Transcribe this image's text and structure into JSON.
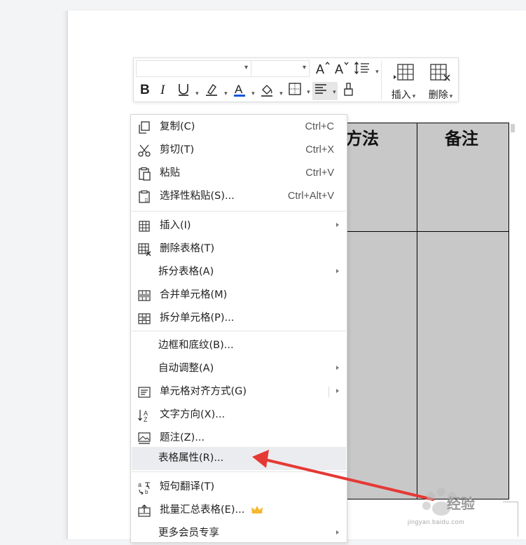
{
  "table": {
    "header_col1": "方法",
    "header_col2": "备注"
  },
  "toolbar": {
    "font_name": "",
    "font_size": "",
    "caret": "▾",
    "insert_label": "插入",
    "delete_label": "删除"
  },
  "menu": {
    "items": [
      {
        "label": "复制(C)",
        "shortcut": "Ctrl+C",
        "icon": "copy-icon"
      },
      {
        "label": "剪切(T)",
        "shortcut": "Ctrl+X",
        "icon": "scissors-icon"
      },
      {
        "label": "粘贴",
        "shortcut": "Ctrl+V",
        "icon": "paste-icon"
      },
      {
        "label": "选择性粘贴(S)...",
        "shortcut": "Ctrl+Alt+V",
        "icon": "paste-special-icon"
      },
      {
        "label": "插入(I)",
        "icon": "table-insert-icon"
      },
      {
        "label": "删除表格(T)",
        "icon": "table-delete-icon"
      },
      {
        "label": "拆分表格(A)"
      },
      {
        "label": "合并单元格(M)",
        "icon": "merge-cells-icon"
      },
      {
        "label": "拆分单元格(P)...",
        "icon": "split-cells-icon"
      },
      {
        "label": "边框和底纹(B)..."
      },
      {
        "label": "自动调整(A)"
      },
      {
        "label": "单元格对齐方式(G)",
        "icon": "cell-align-icon"
      },
      {
        "label": "文字方向(X)...",
        "icon": "text-direction-icon"
      },
      {
        "label": "题注(Z)...",
        "icon": "caption-icon"
      },
      {
        "label": "表格属性(R)..."
      },
      {
        "label": "短句翻译(T)",
        "icon": "translate-icon"
      },
      {
        "label": "批量汇总表格(E)...",
        "icon": "batch-summary-icon"
      },
      {
        "label": "更多会员专享"
      }
    ],
    "hovered_item": "表格属性(R)..."
  },
  "watermark": {
    "text": "经验",
    "url": "jingyan.baidu.com"
  },
  "colors": {
    "accent_blue": "#1a56db",
    "arrow_red": "#e53935",
    "crown_gold": "#f5b82e",
    "table_fill": "#c8c8c8"
  }
}
